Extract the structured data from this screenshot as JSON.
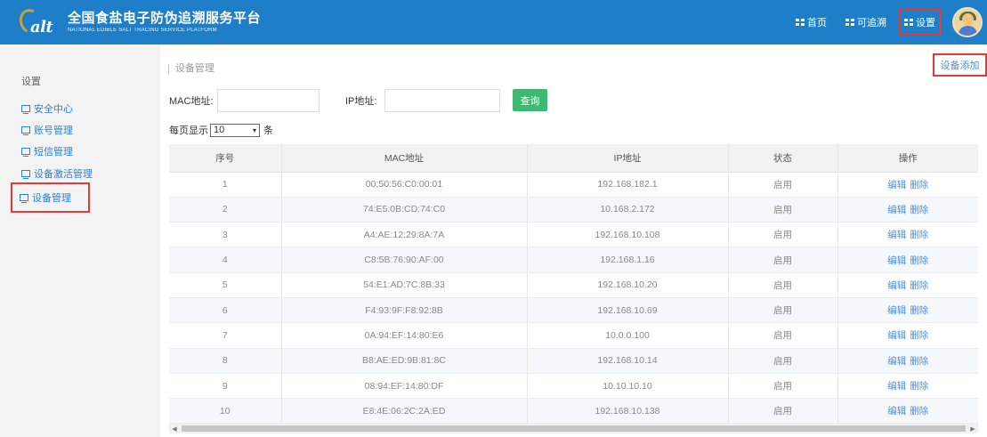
{
  "header": {
    "logo_salt": "alt",
    "title_cn": "全国食盐电子防伪追溯服务平台",
    "title_en": "NATIONAL EDIBLE SALT TRACING SERVICE PLATFORM",
    "nav": [
      {
        "label": "首页",
        "icon": "grid-icon"
      },
      {
        "label": "可追溯",
        "icon": "grid-icon"
      },
      {
        "label": "设置",
        "icon": "grid-icon",
        "active": true
      }
    ]
  },
  "sidebar": {
    "title": "设置",
    "items": [
      {
        "label": "安全中心",
        "icon": "monitor-icon"
      },
      {
        "label": "账号管理",
        "icon": "monitor-icon"
      },
      {
        "label": "短信管理",
        "icon": "monitor-icon"
      },
      {
        "label": "设备激活管理",
        "icon": "monitor-icon"
      },
      {
        "label": "设备管理",
        "icon": "monitor-icon",
        "selected": true
      }
    ]
  },
  "main": {
    "breadcrumb": "设备管理",
    "add_label": "设备添加",
    "search": {
      "mac_label": "MAC地址:",
      "mac_value": "",
      "ip_label": "IP地址:",
      "ip_value": "",
      "query_label": "查询"
    },
    "pagesize": {
      "prefix": "每页显示",
      "value": "10",
      "unit": "条"
    },
    "table": {
      "columns": [
        "序号",
        "MAC地址",
        "IP地址",
        "状态",
        "操作"
      ],
      "edit_label": "编辑",
      "delete_label": "删除",
      "rows": [
        {
          "no": "1",
          "mac": "00:50:56:C0:00:01",
          "ip": "192.168.182.1",
          "status": "启用"
        },
        {
          "no": "2",
          "mac": "74:E5:0B:CD:74:C0",
          "ip": "10.168.2.172",
          "status": "启用"
        },
        {
          "no": "3",
          "mac": "A4:AE:12:29:8A:7A",
          "ip": "192.168.10.108",
          "status": "启用"
        },
        {
          "no": "4",
          "mac": "C8:5B:76:90:AF:00",
          "ip": "192.168.1.16",
          "status": "启用"
        },
        {
          "no": "5",
          "mac": "54:E1:AD:7C:8B:33",
          "ip": "192.168.10.20",
          "status": "启用"
        },
        {
          "no": "6",
          "mac": "F4:93:9F:F8:92:8B",
          "ip": "192.168.10.69",
          "status": "启用"
        },
        {
          "no": "7",
          "mac": "0A:94:EF:14:80:E6",
          "ip": "10.0.0.100",
          "status": "启用"
        },
        {
          "no": "8",
          "mac": "B8:AE:ED:9B:81:8C",
          "ip": "192.168.10.14",
          "status": "启用"
        },
        {
          "no": "9",
          "mac": "08:94:EF:14:80:DF",
          "ip": "10.10.10.10",
          "status": "启用"
        },
        {
          "no": "10",
          "mac": "E8:4E:06:2C:2A:ED",
          "ip": "192.168.10.138",
          "status": "启用"
        }
      ]
    }
  },
  "colors": {
    "header_bg": "#1f7ec8",
    "accent_link": "#4a8fe0",
    "query_button": "#3fb874",
    "highlight_outline": "#e53935"
  }
}
